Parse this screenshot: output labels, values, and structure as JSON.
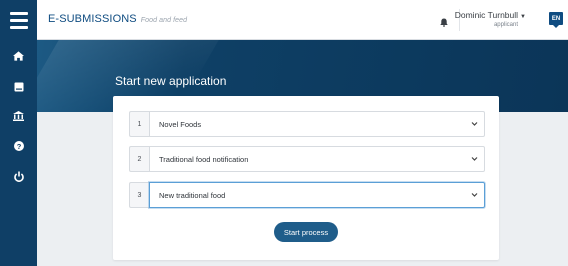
{
  "app": {
    "brand": "E-SUBMISSIONS",
    "brand_sub": "Food and feed"
  },
  "user": {
    "name": "Dominic Turnbull",
    "role": "applicant",
    "language": "EN"
  },
  "sidebar": {
    "items": [
      {
        "icon": "home-icon"
      },
      {
        "icon": "book-icon"
      },
      {
        "icon": "bank-icon"
      },
      {
        "icon": "help-icon"
      },
      {
        "icon": "power-icon"
      }
    ]
  },
  "page": {
    "title": "Start new application"
  },
  "form": {
    "rows": [
      {
        "number": "1",
        "value": "Novel Foods"
      },
      {
        "number": "2",
        "value": "Traditional food notification"
      },
      {
        "number": "3",
        "value": "New traditional food"
      }
    ],
    "submit_label": "Start process"
  },
  "colors": {
    "sidebar": "#0f3f66",
    "brand": "#0f4c81",
    "button": "#1f5d8a",
    "active_border": "#5b9fd6"
  }
}
